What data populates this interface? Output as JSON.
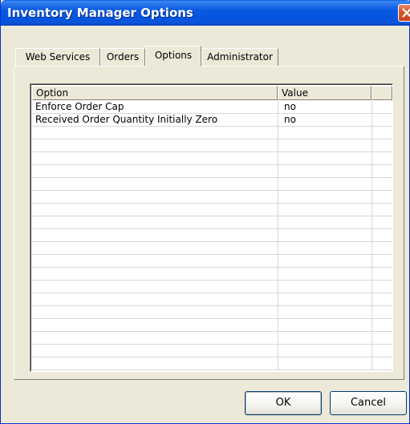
{
  "window": {
    "title": "Inventory Manager Options"
  },
  "tabs": [
    {
      "label": "Web Services",
      "active": false
    },
    {
      "label": "Orders",
      "active": false
    },
    {
      "label": "Options",
      "active": true
    },
    {
      "label": "Administrator",
      "active": false
    }
  ],
  "options_list": {
    "columns": [
      "Option",
      "Value"
    ],
    "rows": [
      {
        "option": "Enforce Order Cap",
        "value": "no"
      },
      {
        "option": "Received Order Quantity Initially Zero",
        "value": "no"
      }
    ]
  },
  "buttons": {
    "ok_label": "OK",
    "cancel_label": "Cancel"
  },
  "icons": {
    "close": "close-icon"
  },
  "colors": {
    "titlebar": "#0a5ae0",
    "dialog_bg": "#ece9d8",
    "close_button": "#d8592f"
  }
}
